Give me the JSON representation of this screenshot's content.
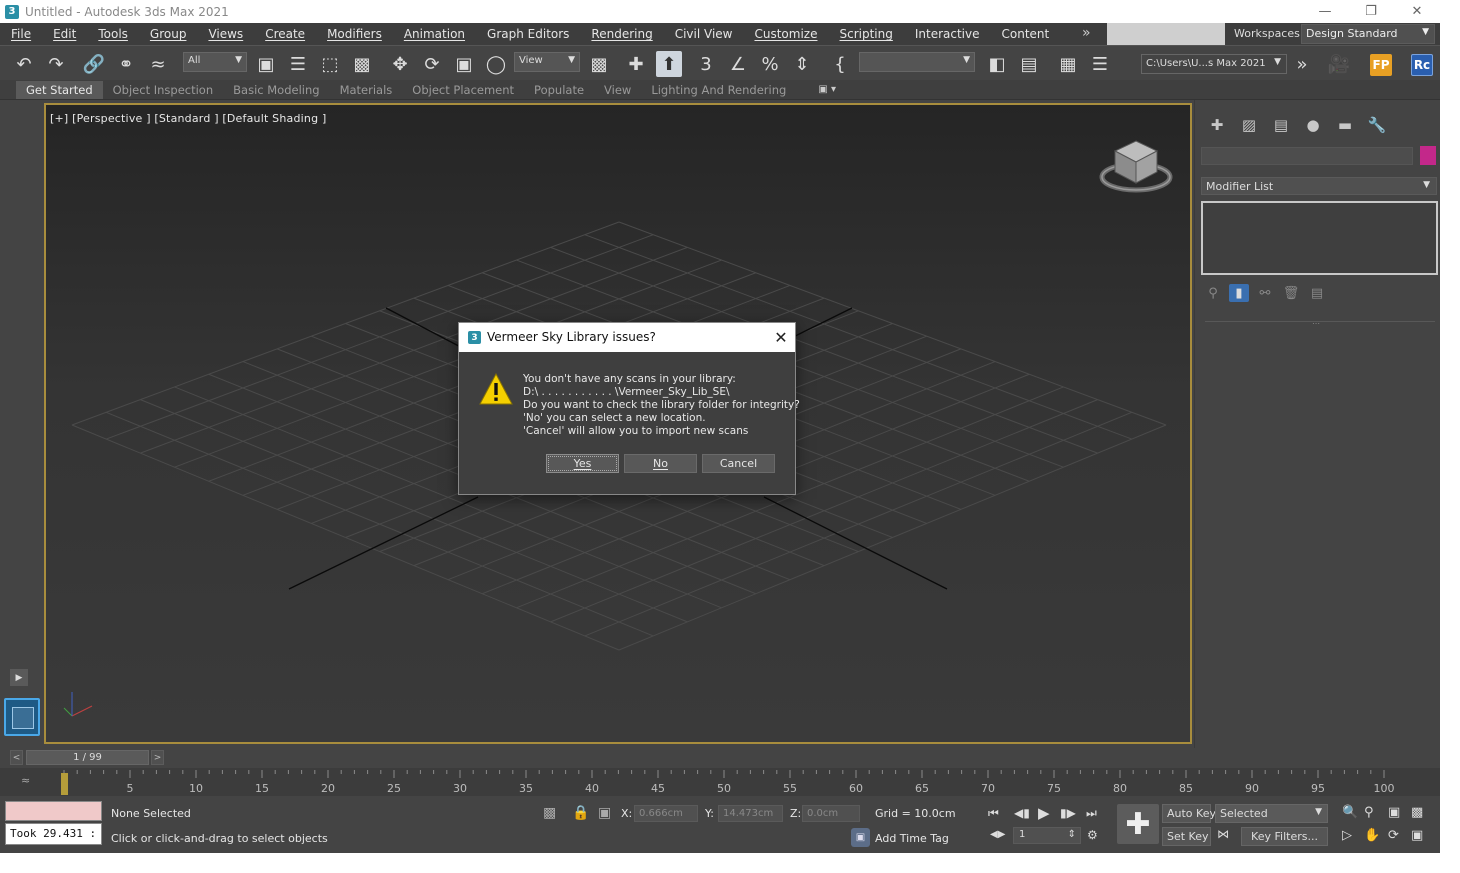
{
  "window": {
    "title": "Untitled - Autodesk 3ds Max 2021",
    "app_icon": "3ds-max-icon",
    "controls": [
      "minimize-icon",
      "restore-icon",
      "close-icon"
    ]
  },
  "menu": {
    "items": [
      "File",
      "Edit",
      "Tools",
      "Group",
      "Views",
      "Create",
      "Modifiers",
      "Animation",
      "Graph Editors",
      "Rendering",
      "Civil View",
      "Customize",
      "Scripting",
      "Interactive",
      "Content"
    ],
    "workspaces_label": "Workspaces:",
    "workspace_value": "Design Standard"
  },
  "toolbar": {
    "filter_value": "All",
    "coord_system_value": "View",
    "named_selection_value": "",
    "project_path": "C:\\Users\\U...s Max 2021",
    "badge_fp": "FP",
    "badge_rc": "Rc"
  },
  "ribbon": {
    "tabs": [
      "Get Started",
      "Object Inspection",
      "Basic Modeling",
      "Materials",
      "Object Placement",
      "Populate",
      "View",
      "Lighting And Rendering"
    ],
    "active_tab": "Get Started"
  },
  "viewport": {
    "label": "[+] [Perspective ] [Standard ] [Default Shading ]",
    "border_color": "#a88d3d"
  },
  "command_panel": {
    "object_color": "#c3288a",
    "modifier_list_label": "Modifier List"
  },
  "timeline": {
    "frame_display": "1 / 99",
    "ticks": [
      "5",
      "10",
      "15",
      "20",
      "25",
      "30",
      "35",
      "40",
      "45",
      "50",
      "55",
      "60",
      "65",
      "70",
      "75",
      "80",
      "85",
      "90",
      "95",
      "100"
    ]
  },
  "status": {
    "selection": "None Selected",
    "hint": "Click or click-and-drag to select objects",
    "took": "Took 29.431 :",
    "x_label": "X:",
    "x_value": "0.666cm",
    "y_label": "Y:",
    "y_value": "14.473cm",
    "z_label": "Z:",
    "z_value": "0.0cm",
    "grid": "Grid = 10.0cm",
    "add_time_tag": "Add Time Tag",
    "current_frame": "1",
    "auto_key": "Auto Key",
    "set_key": "Set Key",
    "selected": "Selected",
    "key_filters": "Key Filters..."
  },
  "dialog": {
    "title": "Vermeer Sky Library issues?",
    "lines": [
      "You don't have any scans in your library:",
      "D:\\ . . . . . . . . . . . \\Vermeer_Sky_Lib_SE\\",
      "Do you want to check the library folder for integrity?",
      "'No' you can select a new location.",
      "'Cancel' will allow you to import new scans"
    ],
    "yes": "Yes",
    "no": "No",
    "cancel": "Cancel",
    "icon": "warning-icon"
  }
}
